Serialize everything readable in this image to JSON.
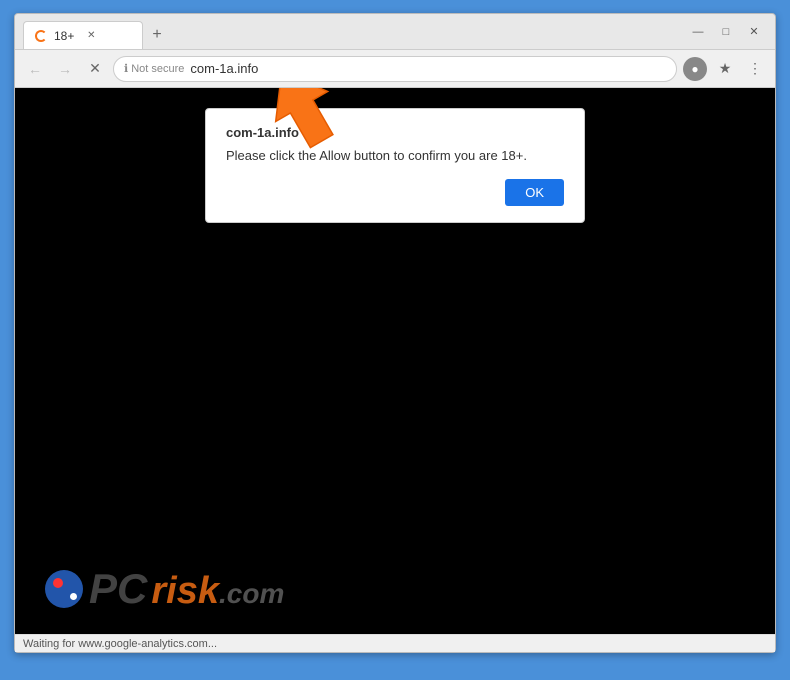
{
  "browser": {
    "tab": {
      "title": "18+",
      "favicon": "spinner-icon"
    },
    "addressBar": {
      "back_label": "←",
      "forward_label": "→",
      "reload_label": "✕",
      "security": "Not secure",
      "url": "com-1a.info",
      "bookmark_icon": "star-icon",
      "menu_icon": "menu-icon",
      "profile_icon": "profile-icon"
    },
    "windowControls": {
      "minimize": "—",
      "maximize": "□",
      "close": "✕"
    }
  },
  "dialog": {
    "site": "com-1a.info says",
    "message": "Please click the Allow button to confirm you are 18+.",
    "ok_label": "OK"
  },
  "statusBar": {
    "text": "Waiting for www.google-analytics.com..."
  },
  "watermark": {
    "text": "PC",
    "risk": "risk",
    "dotcom": ".com"
  }
}
